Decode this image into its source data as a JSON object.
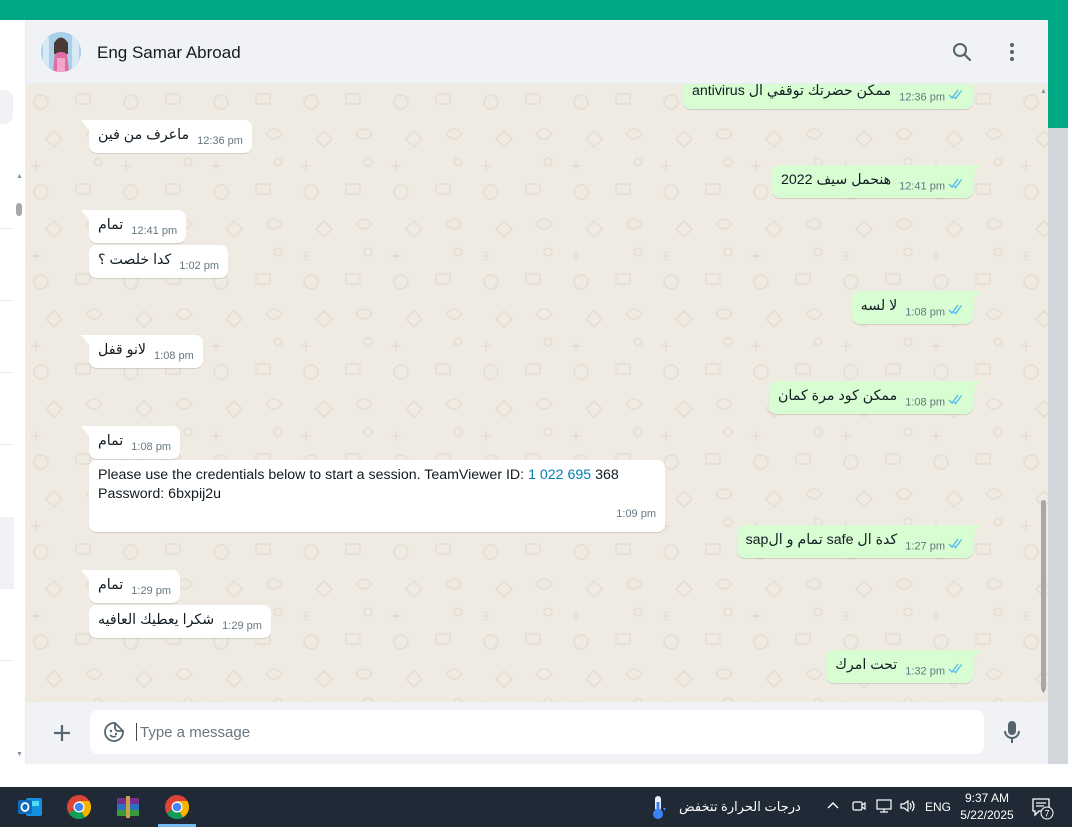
{
  "colors": {
    "accent": "#00a884",
    "header_bg": "#f0f2f5",
    "chat_bg": "#efeae2",
    "incoming_bubble": "#ffffff",
    "outgoing_bubble": "#d9fdd3",
    "read_tick": "#53bdeb",
    "taskbar": "#1f2a36"
  },
  "header": {
    "contact_name": "Eng Samar Abroad",
    "icons": [
      "search-icon",
      "menu-icon"
    ]
  },
  "messages": [
    {
      "dir": "out",
      "text": "ممكن حضرتك توقفي ال antivirus",
      "time": "12:36 pm",
      "status": "read"
    },
    {
      "dir": "in",
      "text": "ماعرف من فين",
      "time": "12:36 pm"
    },
    {
      "dir": "out",
      "text": "هنحمل سيف 2022",
      "time": "12:41 pm",
      "status": "read"
    },
    {
      "dir": "in",
      "text": "تمام",
      "time": "12:41 pm"
    },
    {
      "dir": "in",
      "text": "كدا خلصت ؟",
      "time": "1:02 pm"
    },
    {
      "dir": "out",
      "text": "لا لسه",
      "time": "1:08 pm",
      "status": "read"
    },
    {
      "dir": "in",
      "text": "لانو قفل",
      "time": "1:08 pm"
    },
    {
      "dir": "out",
      "text": "ممكن كود مرة كمان",
      "time": "1:08 pm",
      "status": "read"
    },
    {
      "dir": "in",
      "text": "تمام",
      "time": "1:08 pm"
    },
    {
      "dir": "in",
      "text_before": "Please use the credentials below to start a session. TeamViewer ID: ",
      "link": "1 022 695",
      "text_after": " 368",
      "line2": "Password: 6bxpij2u",
      "time": "1:09 pm"
    },
    {
      "dir": "out",
      "text": "كدة ال safe تمام و الsap",
      "time": "1:27 pm",
      "status": "read"
    },
    {
      "dir": "in",
      "text": "تمام",
      "time": "1:29 pm"
    },
    {
      "dir": "in",
      "text": "شكرا يعطيك العافيه",
      "time": "1:29 pm"
    },
    {
      "dir": "out",
      "text": "تحت امرك",
      "time": "1:32 pm",
      "status": "read"
    }
  ],
  "composer": {
    "placeholder": "Type a message",
    "icons": [
      "plus-icon",
      "sticker-icon",
      "mic-icon"
    ]
  },
  "taskbar": {
    "apps": [
      "outlook-icon",
      "chrome-icon",
      "winrar-icon",
      "chrome-icon-active"
    ],
    "weather_text": "درجات الحرارة تتخفض",
    "language": "ENG",
    "time": "9:37 AM",
    "date": "5/22/2025",
    "notification_count": "7"
  }
}
